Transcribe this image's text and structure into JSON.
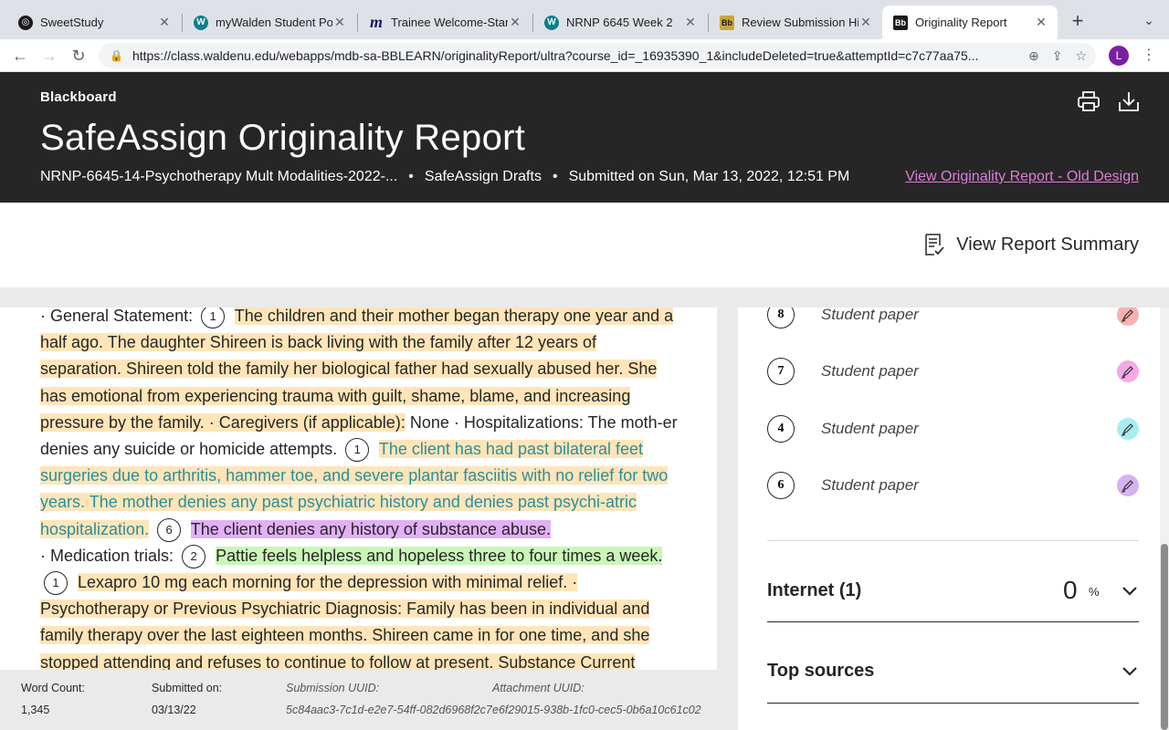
{
  "browser": {
    "tabs": [
      {
        "title": "SweetStudy",
        "favicon": "sweetstudy-icon",
        "color": "#1a1a1a"
      },
      {
        "title": "myWalden Student Portal",
        "favicon": "walden-w-icon",
        "color": "#0b7f8a"
      },
      {
        "title": "Trainee Welcome-Start Here",
        "favicon": "mediasite-m-icon",
        "color": "#1a1a1a"
      },
      {
        "title": "NRNP 6645 Week 2",
        "favicon": "walden-w-icon",
        "color": "#0b7f8a"
      },
      {
        "title": "Review Submission History",
        "favicon": "blackboard-bb-icon",
        "color": "#1a1a1a"
      },
      {
        "title": "Originality Report",
        "favicon": "blackboard-bb-icon",
        "color": "#1a1a1a"
      }
    ],
    "url": "https://class.waldenu.edu/webapps/mdb-sa-BBLEARN/originalityReport/ultra?course_id=_16935390_1&includeDeleted=true&attemptId=c7c77aa75...",
    "profile_initial": "L"
  },
  "header": {
    "brand": "Blackboard",
    "title": "SafeAssign Originality Report",
    "course": "NRNP-6645-14-Psychotherapy Mult Modalities-2022-...",
    "section": "SafeAssign Drafts",
    "submitted": "Submitted on Sun, Mar 13, 2022, 12:51 PM",
    "old_design_link": "View Originality Report - Old Design"
  },
  "summary": {
    "label": "View Report Summary"
  },
  "document": {
    "seg1": "· General Statement:",
    "n1": "1",
    "seg2": "The children and their mother began therapy one year and a half ago. The daughter Shireen is back living with the family after 12 years of separation. Shireen told the family her biological father had sexually abused her. She has emotional from experiencing trauma with guilt, shame, blame, and increasing pressure by the family. · Caregivers (if applicable):",
    "seg3": "None · Hospitalizations: The moth-er denies any suicide or homicide attempts.",
    "n2": "1",
    "seg4": "The client has had past bilateral feet surgeries due to arthritis, hammer toe, and severe plantar fasciitis with no relief for two years. The mother denies any past psychiatric history and denies past psychi-atric hospitalization.",
    "n3": "6",
    "seg5": "The client denies any history of substance abuse.",
    "seg6": "· Medication trials:",
    "n4": "2",
    "seg7": "Pattie feels helpless and hopeless three to four times a week.",
    "n5": "1",
    "seg8": "Lexapro 10 mg each morning for the depression with minimal relief. · Psychotherapy or Previous Psychiatric Diagnosis: Family has been in individual and family therapy over the last eighteen months. Shireen came in for one time, and she stopped attending and refuses to continue to follow at present. Substance Current"
  },
  "footer": {
    "word_count_label": "Word Count:",
    "word_count": "1,345",
    "submitted_label": "Submitted on:",
    "submitted": "03/13/22",
    "submission_uuid_label": "Submission UUID:",
    "submission_uuid": "5c84aac3-7c1d-e2e7-54ff-082d6968f2c7",
    "attachment_uuid_label": "Attachment UUID:",
    "attachment_uuid": "e6f29015-938b-1fc0-cec5-0b6a10c61c02"
  },
  "sources": [
    {
      "num": "8",
      "label": "Student paper",
      "color": "#f7b1b1"
    },
    {
      "num": "7",
      "label": "Student paper",
      "color": "#f5a9e6"
    },
    {
      "num": "4",
      "label": "Student paper",
      "color": "#a8eef0"
    },
    {
      "num": "6",
      "label": "Student paper",
      "color": "#d7b1f0"
    }
  ],
  "sections": {
    "internet_label": "Internet (1)",
    "internet_pct": "0",
    "pct_symbol": "%",
    "top_sources_label": "Top sources"
  }
}
